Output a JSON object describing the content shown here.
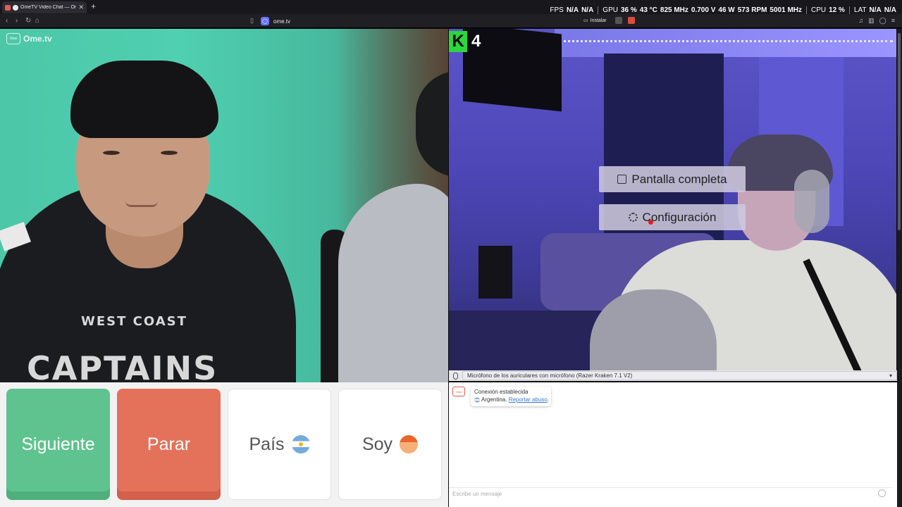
{
  "browser": {
    "tab_title": "OmeTV Video Chat — Omeg",
    "tab_close": "✕",
    "new_tab": "+",
    "url": "ome.tv",
    "install_label": "Instalar",
    "nav": {
      "back": "‹",
      "forward": "›",
      "reload": "↻",
      "home": "⌂"
    },
    "bookmark": "🔖"
  },
  "hud": {
    "fps_label": "FPS",
    "fps_values": [
      "N/A",
      "N/A"
    ],
    "gpu_label": "GPU",
    "gpu_values": [
      "36 %",
      "43 °C",
      "825 MHz",
      "0.700 V",
      "46 W",
      "573 RPM",
      "5001 MHz"
    ],
    "cpu_label": "CPU",
    "cpu_value": "12 %",
    "lat_label": "LAT",
    "lat_values": [
      "N/A",
      "N/A"
    ]
  },
  "video_left": {
    "logo_text": "Ome.tv",
    "logo_small": "Ome",
    "shirt_line1": "WEST COAST",
    "shirt_line2": "CAPTAINS"
  },
  "video_right": {
    "channel_logo": "K",
    "channel_num": "4",
    "menu": {
      "fullscreen": "Pantalla completa",
      "settings": "Configuración"
    },
    "mic_label": "Micrófono de los auriculares con micrófono (Razer Kraken 7.1 V2)",
    "mic_dropdown": "▾"
  },
  "controls": {
    "next": "Siguiente",
    "stop": "Parar",
    "country": "País",
    "gender": "Soy"
  },
  "chat": {
    "logo": "Ome",
    "status": "Conexión establecida",
    "country": "Argentina.",
    "report": "Reportar abuso",
    "report_suffix": ".",
    "input_placeholder": "Escribe un mensaje"
  },
  "colors": {
    "next": "#5ec38e",
    "stop": "#e4725a",
    "accent_green": "#2bd63f",
    "link": "#3b78d6"
  }
}
